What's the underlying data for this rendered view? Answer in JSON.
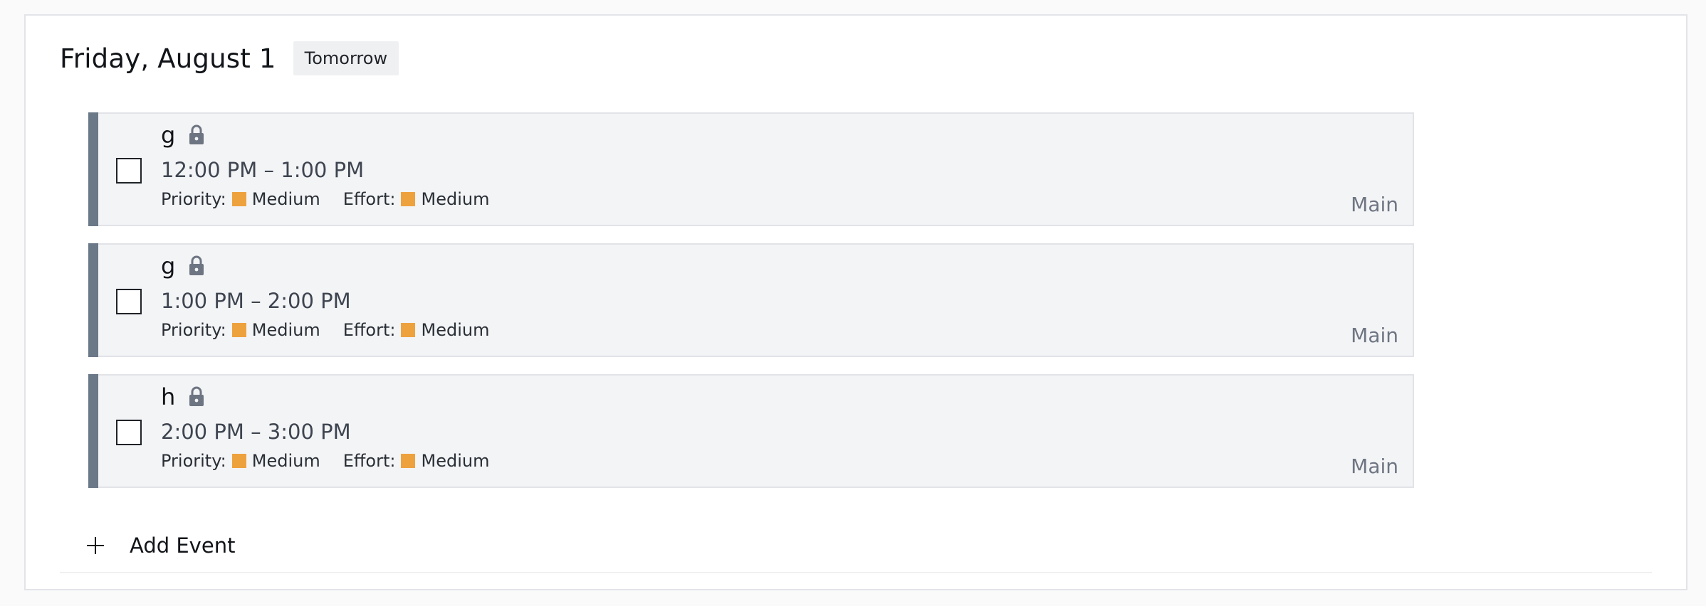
{
  "day": {
    "title": "Friday, August 1",
    "badge": "Tomorrow"
  },
  "events": [
    {
      "title": "g",
      "time": "12:00 PM – 1:00 PM",
      "priority_label": "Priority:",
      "priority_value": "Medium",
      "effort_label": "Effort:",
      "effort_value": "Medium",
      "calendar": "Main",
      "locked": true
    },
    {
      "title": "g",
      "time": "1:00 PM – 2:00 PM",
      "priority_label": "Priority:",
      "priority_value": "Medium",
      "effort_label": "Effort:",
      "effort_value": "Medium",
      "calendar": "Main",
      "locked": true
    },
    {
      "title": "h",
      "time": "2:00 PM – 3:00 PM",
      "priority_label": "Priority:",
      "priority_value": "Medium",
      "effort_label": "Effort:",
      "effort_value": "Medium",
      "calendar": "Main",
      "locked": true
    }
  ],
  "add_event": {
    "label": "Add Event",
    "icon": "plus-icon"
  },
  "colors": {
    "event_bar": "#6b7888",
    "medium_swatch": "#eea23e",
    "event_bg": "#f3f4f6"
  }
}
